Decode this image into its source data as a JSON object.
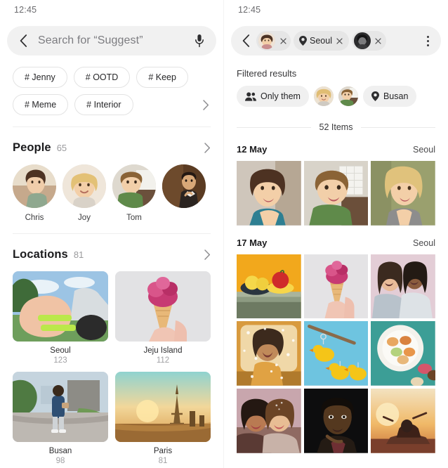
{
  "status": {
    "time_left": "12:45",
    "time_right": "12:45"
  },
  "left": {
    "search": {
      "placeholder": "Search for “Suggest”",
      "back_icon": "chevron-left-icon",
      "mic_icon": "microphone-icon"
    },
    "tags": {
      "row1": [
        "# Jenny",
        "# OOTD",
        "# Keep"
      ],
      "row2": [
        "# Meme",
        "# Interior"
      ],
      "expand_icon": "chevron-right-icon"
    },
    "people": {
      "title": "People",
      "count": "65",
      "chevron_icon": "chevron-right-icon",
      "items": [
        {
          "name": "Chris",
          "avatar": "woman-smiling-portrait"
        },
        {
          "name": "Joy",
          "avatar": "blonde-woman-portrait"
        },
        {
          "name": "Tom",
          "avatar": "boy-green-shirt-portrait"
        },
        {
          "name": "",
          "avatar": "man-dark-suit-portrait"
        }
      ]
    },
    "locations": {
      "title": "Locations",
      "count": "81",
      "chevron_icon": "chevron-right-icon",
      "items": [
        {
          "name": "Seoul",
          "count": "123",
          "thumb": "hands-wristbands-outdoor"
        },
        {
          "name": "Jeju Island",
          "count": "112",
          "thumb": "pink-ice-cream-cone"
        },
        {
          "name": "Busan",
          "count": "98",
          "thumb": "person-walking-street"
        },
        {
          "name": "Paris",
          "count": "81",
          "thumb": "eiffel-tower-sunset"
        }
      ]
    }
  },
  "right": {
    "filterbar": {
      "back_icon": "chevron-left-icon",
      "menu_icon": "more-vertical-icon",
      "chips": [
        {
          "type": "avatar",
          "label": "",
          "avatar": "woman-smiling-portrait",
          "remove_icon": "close-icon"
        },
        {
          "type": "location",
          "label": "Seoul",
          "icon": "location-pin-icon",
          "remove_icon": "close-icon"
        },
        {
          "type": "avatar",
          "label": "",
          "avatar": "person-dark-portrait",
          "remove_icon": "close-icon"
        }
      ]
    },
    "filtered": {
      "title": "Filtered results",
      "only_them_label": "Only them",
      "only_them_icon": "people-group-icon",
      "avatars": [
        "blonde-woman-portrait",
        "boy-green-shirt-portrait"
      ],
      "location_chip": {
        "label": "Busan",
        "icon": "location-pin-icon"
      }
    },
    "items_count": "52 Items",
    "groups": [
      {
        "date": "12 May",
        "place": "Seoul",
        "photos": [
          "woman-teal-top-smiling",
          "boy-green-shirt-smiling",
          "blonde-woman-grey-top"
        ]
      },
      {
        "date": "17 May",
        "place": "Seoul",
        "photos": [
          "fruit-bowl-yellow-background",
          "pink-ice-cream-cone-hand",
          "two-women-laughing-pink-wall",
          "woman-confetti-car-window",
          "rubber-ducks-blue-background",
          "macarons-plate-teal",
          "two-women-smiling-festival",
          "man-portrait-black-background",
          "couple-car-sunset-silhouette"
        ]
      }
    ]
  }
}
